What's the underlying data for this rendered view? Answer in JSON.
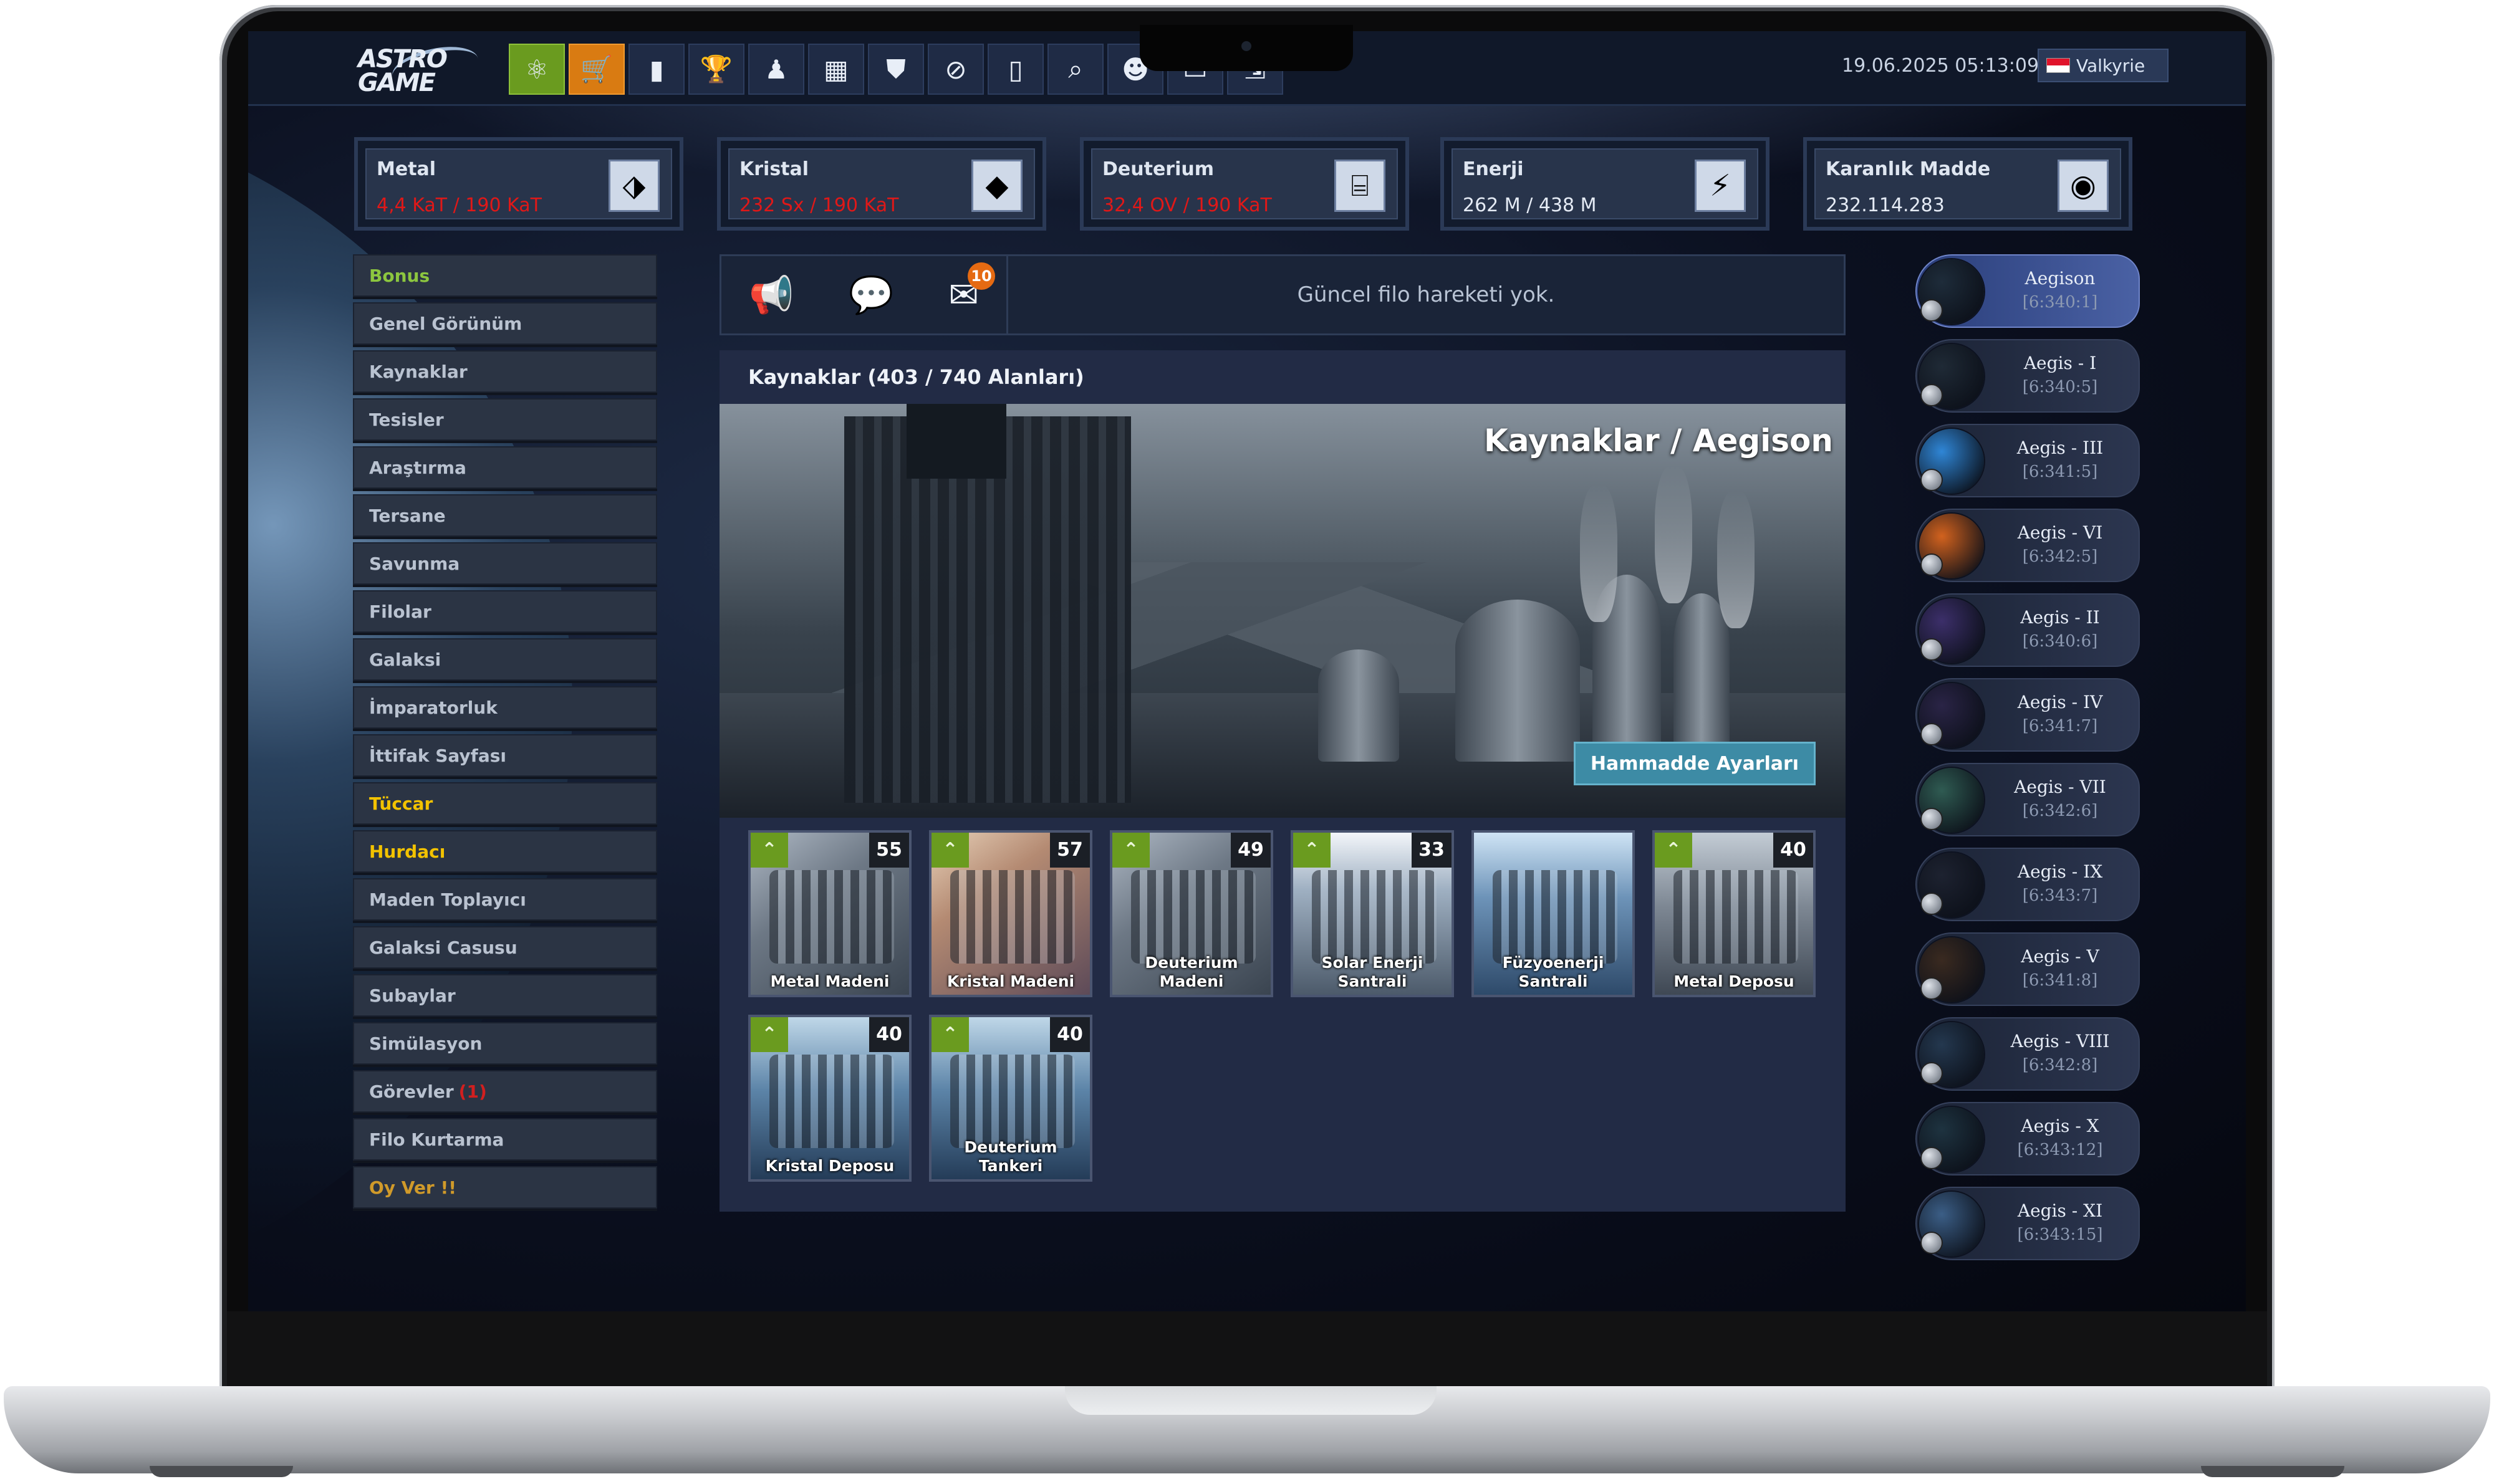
{
  "topbar": {
    "logo_text": "ASTRO\nGAME",
    "datetime": "19.06.2025 05:13:09",
    "username": "Valkyrie",
    "nav_icons": [
      "galaxy-icon",
      "shop-icon",
      "stats-icon",
      "trophy-icon",
      "officer-icon",
      "calculator-icon",
      "shield-icon",
      "ban-icon",
      "book-icon",
      "search-icon",
      "user-icon",
      "chat-icon",
      "logout-icon"
    ]
  },
  "resources": [
    {
      "name": "Metal",
      "value": "4,4 KaT / 190 KaT",
      "over": true,
      "icon": "metal-icon"
    },
    {
      "name": "Kristal",
      "value": "232 Sx / 190 KaT",
      "over": true,
      "icon": "crystal-icon"
    },
    {
      "name": "Deuterium",
      "value": "32,4 OV / 190 KaT",
      "over": true,
      "icon": "deuterium-icon"
    },
    {
      "name": "Enerji",
      "value": "262 M / 438 M",
      "over": false,
      "icon": "energy-icon"
    },
    {
      "name": "Karanlık Madde",
      "value": "232.114.283",
      "over": false,
      "icon": "dark-matter-icon"
    }
  ],
  "menu": [
    {
      "label": "Bonus",
      "style": "bonus"
    },
    {
      "label": "Genel Görünüm",
      "style": ""
    },
    {
      "label": "Kaynaklar",
      "style": ""
    },
    {
      "label": "Tesisler",
      "style": ""
    },
    {
      "label": "Araştırma",
      "style": ""
    },
    {
      "label": "Tersane",
      "style": ""
    },
    {
      "label": "Savunma",
      "style": ""
    },
    {
      "label": "Filolar",
      "style": ""
    },
    {
      "label": "Galaksi",
      "style": ""
    },
    {
      "label": "İmparatorluk",
      "style": ""
    },
    {
      "label": "İttifak Sayfası",
      "style": ""
    },
    {
      "label": "Tüccar",
      "style": "yellow"
    },
    {
      "label": "Hurdacı",
      "style": "yellow"
    },
    {
      "label": "Maden Toplayıcı",
      "style": ""
    },
    {
      "label": "Galaksi Casusu",
      "style": ""
    },
    {
      "label": "Subaylar",
      "style": ""
    },
    {
      "label": "Simülasyon",
      "style": ""
    },
    {
      "label": "Görevler",
      "style": "",
      "badge": "(1)"
    },
    {
      "label": "Filo Kurtarma",
      "style": ""
    },
    {
      "label": "Oy Ver !!",
      "style": "vote"
    }
  ],
  "fleet": {
    "status": "Güncel filo hareketi yok.",
    "mail_count": "10"
  },
  "panel": {
    "title": "Kaynaklar (403 / 740 Alanları)",
    "hero_title": "Kaynaklar / Aegison",
    "hero_button": "Hammadde Ayarları"
  },
  "buildings": [
    {
      "name": "Metal Madeni",
      "level": "55",
      "upgrade": true,
      "theme": ""
    },
    {
      "name": "Kristal Madeni",
      "level": "57",
      "upgrade": true,
      "theme": "crystal"
    },
    {
      "name": "Deuterium Madeni",
      "level": "49",
      "upgrade": true,
      "theme": ""
    },
    {
      "name": "Solar Enerji Santrali",
      "level": "33",
      "upgrade": true,
      "theme": "solar"
    },
    {
      "name": "Füzyoenerji Santrali",
      "level": "",
      "upgrade": false,
      "theme": "fusion"
    },
    {
      "name": "Metal Deposu",
      "level": "40",
      "upgrade": true,
      "theme": "deposit"
    },
    {
      "name": "Kristal Deposu",
      "level": "40",
      "upgrade": true,
      "theme": "blue"
    },
    {
      "name": "Deuterium Tankeri",
      "level": "40",
      "upgrade": true,
      "theme": "blue"
    }
  ],
  "planets": [
    {
      "name": "Aegison",
      "coord": "[6:340:1]",
      "active": true,
      "color": "#1e2c3a"
    },
    {
      "name": "Aegis - I",
      "coord": "[6:340:5]",
      "active": false,
      "color": "#1f2a36"
    },
    {
      "name": "Aegis - III",
      "coord": "[6:341:5]",
      "active": false,
      "color": "#2f86d6"
    },
    {
      "name": "Aegis - VI",
      "coord": "[6:342:5]",
      "active": false,
      "color": "#d2621e"
    },
    {
      "name": "Aegis - II",
      "coord": "[6:340:6]",
      "active": false,
      "color": "#3c2f6a"
    },
    {
      "name": "Aegis - IV",
      "coord": "[6:341:7]",
      "active": false,
      "color": "#2a2446"
    },
    {
      "name": "Aegis - VII",
      "coord": "[6:342:6]",
      "active": false,
      "color": "#2f5b52"
    },
    {
      "name": "Aegis - IX",
      "coord": "[6:343:7]",
      "active": false,
      "color": "#1d2230"
    },
    {
      "name": "Aegis - V",
      "coord": "[6:341:8]",
      "active": false,
      "color": "#3a2a20"
    },
    {
      "name": "Aegis - VIII",
      "coord": "[6:342:8]",
      "active": false,
      "color": "#24384f"
    },
    {
      "name": "Aegis - X",
      "coord": "[6:343:12]",
      "active": false,
      "color": "#1e3340"
    },
    {
      "name": "Aegis - XI",
      "coord": "[6:343:15]",
      "active": false,
      "color": "#3b5e86"
    }
  ]
}
